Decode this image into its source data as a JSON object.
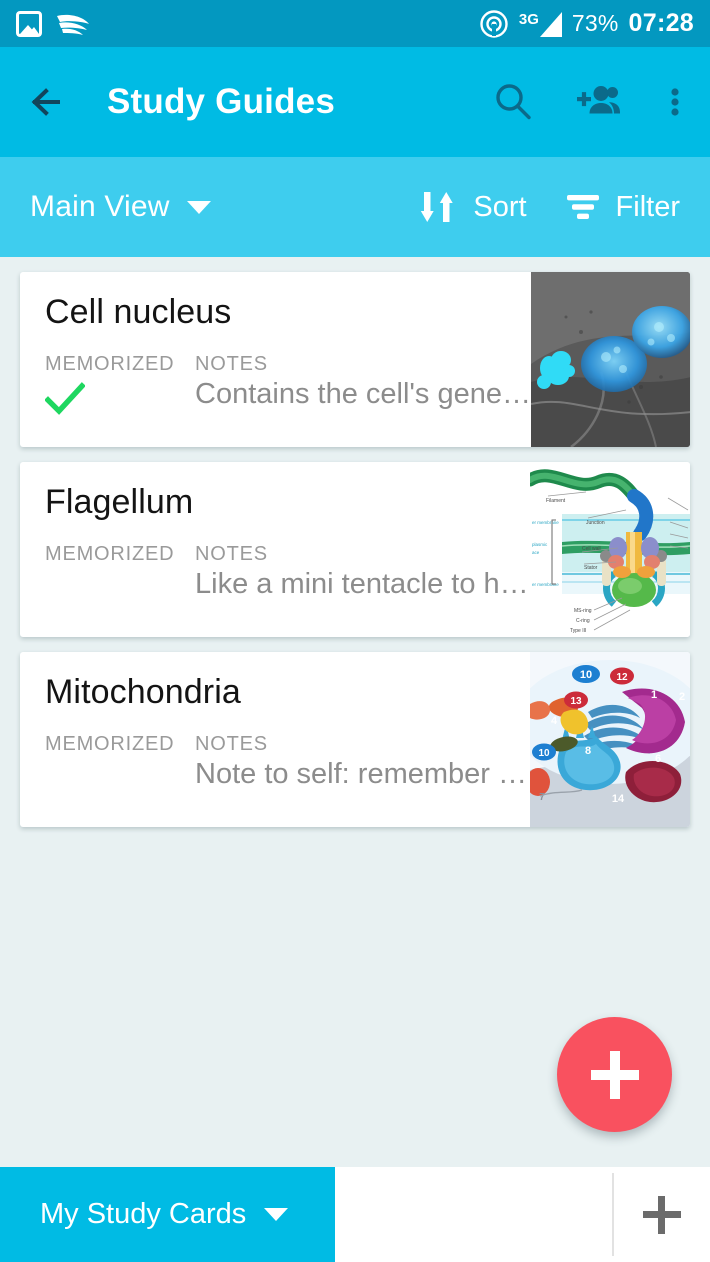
{
  "colors": {
    "status_bar": "#0398C0",
    "app_bar": "#00BBE4",
    "sub_bar": "#3ECDEE",
    "page_background": "#E8F1F2",
    "card_background": "#FFFFFF",
    "accent_fab": "#F9515F",
    "check_green": "#1ED760",
    "icon_dark_teal": "#0B6A8A",
    "muted_text": "#9A9A9A"
  },
  "status_bar": {
    "left_icons": [
      "gallery-icon",
      "swiftkey-swoosh-icon"
    ],
    "cast_icon": "cast-icon",
    "network_label": "3G",
    "signal_icon": "signal-bars-icon",
    "battery": "73%",
    "time": "07:28"
  },
  "app_bar": {
    "back_icon": "back-arrow-icon",
    "title": "Study Guides",
    "actions": [
      {
        "name": "search-icon",
        "label": "Search"
      },
      {
        "name": "add-people-icon",
        "label": "Add people"
      },
      {
        "name": "overflow-menu-icon",
        "label": "More options"
      }
    ]
  },
  "sub_bar": {
    "view_label": "Main View",
    "view_caret": "chevron-down-icon",
    "sort": {
      "label": "Sort",
      "icon": "sort-arrows-icon"
    },
    "filter": {
      "label": "Filter",
      "icon": "filter-icon"
    }
  },
  "card_columns": {
    "memorized": "MEMORIZED",
    "notes": "NOTES"
  },
  "cards": [
    {
      "title": "Cell nucleus",
      "memorized": true,
      "memorized_icon": "check-icon",
      "notes": "Contains the cell's gene…",
      "thumbnail": "microscopy-cell-nuclei-image"
    },
    {
      "title": "Flagellum",
      "memorized": false,
      "memorized_icon": "",
      "notes": "Like a mini tentacle to h…",
      "thumbnail": "bacterial-flagellum-diagram-image"
    },
    {
      "title": "Mitochondria",
      "memorized": false,
      "memorized_icon": "",
      "notes": "Note to self: remember …",
      "thumbnail": "cell-organelles-illustration-image"
    }
  ],
  "fab": {
    "icon": "plus-icon",
    "label": "Add"
  },
  "bottom_bar": {
    "tab_label": "My Study Cards",
    "tab_caret": "chevron-down-icon",
    "add_icon": "plus-icon"
  }
}
